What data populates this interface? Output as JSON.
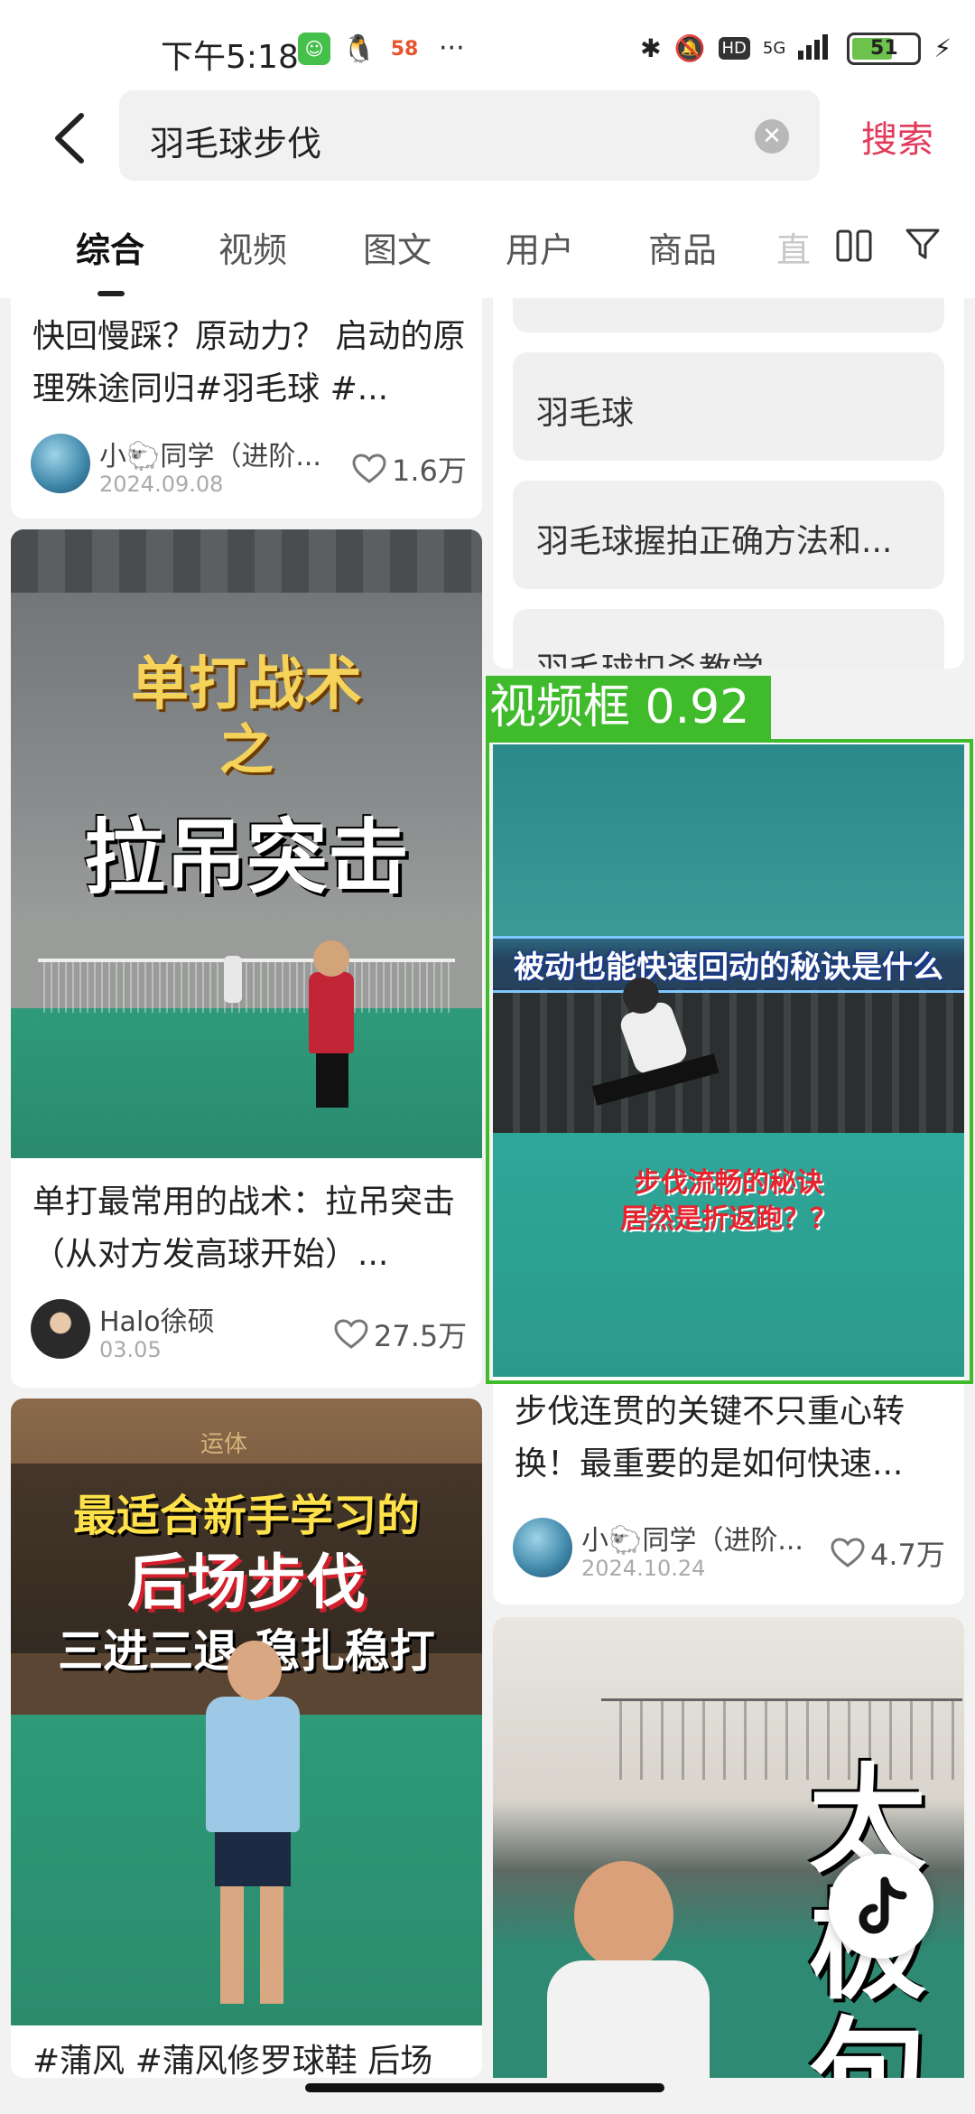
{
  "status": {
    "time": "下午5:18",
    "more": "···",
    "network": "5G",
    "hd": "HD",
    "battery": "51",
    "app58": "58"
  },
  "search": {
    "query": "羽毛球步伐",
    "button": "搜索"
  },
  "tabs": [
    "综合",
    "视频",
    "图文",
    "用户",
    "商品"
  ],
  "tab_fade": "直",
  "left_col": {
    "card1": {
      "title": "快回慢踩？原动力？ 启动的原理殊途同归#羽毛球 #...",
      "user": "小🐑同学（进阶...",
      "date": "2024.09.08",
      "likes": "1.6万"
    },
    "card2": {
      "overlay1": "单打战术",
      "overlay2": "之",
      "overlay3": "拉吊突击",
      "title": "单打最常用的战术：拉吊突击（从对方发高球开始）...",
      "user": "Halo徐硕",
      "date": "03.05",
      "likes": "27.5万"
    },
    "card3": {
      "sign": "运体",
      "overlay1": "最适合新手学习的",
      "overlay2": "后场步伐",
      "overlay3": "三进三退 稳扎稳打",
      "title": "#蒲风 #蒲风修罗球鞋 后场"
    }
  },
  "right_col": {
    "suggestions": [
      "羽毛球",
      "羽毛球握拍正确方法和...",
      "羽毛球扣杀教学"
    ],
    "detection_label": "视频框 0.92",
    "card1": {
      "overlay1": "被动也能快速回动的秘诀是什么",
      "overlay2": "步伐流畅的秘诀",
      "overlay3": "居然是折返跑？？",
      "title": "步伐连贯的关键不只重心转换！最重要的是如何快速...",
      "user": "小🐑同学（进阶...",
      "date": "2024.10.24",
      "likes": "4.7万"
    },
    "card2": {
      "overlay1": "太",
      "overlay2": "极",
      "overlay3": "句"
    }
  }
}
